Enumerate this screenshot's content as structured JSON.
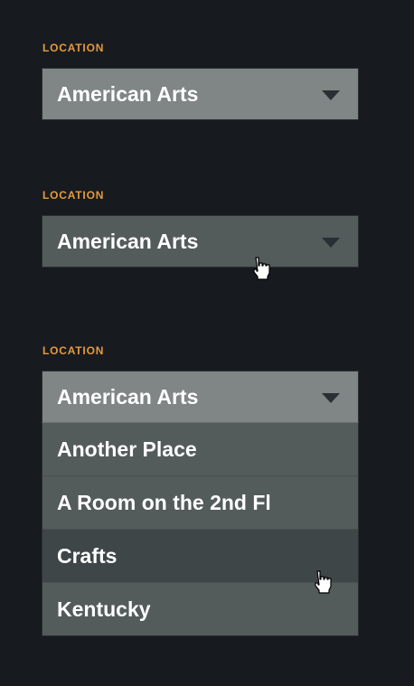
{
  "states": [
    {
      "label": "LOCATION",
      "selected": "American Arts"
    },
    {
      "label": "LOCATION",
      "selected": "American Arts"
    },
    {
      "label": "LOCATION",
      "selected": "American Arts"
    }
  ],
  "dropdown": {
    "options": [
      "Another Place",
      "A Room on the 2nd Fl",
      "Crafts",
      "Kentucky"
    ],
    "highlighted": "Crafts"
  },
  "colors": {
    "background": "#171b1f",
    "label": "#e59a3e",
    "select_default": "#7f8685",
    "select_hover": "#545b5b",
    "option_active": "#3f4648"
  },
  "icons": {
    "caret": "chevron-down-icon",
    "cursor": "hand-pointer-icon"
  }
}
